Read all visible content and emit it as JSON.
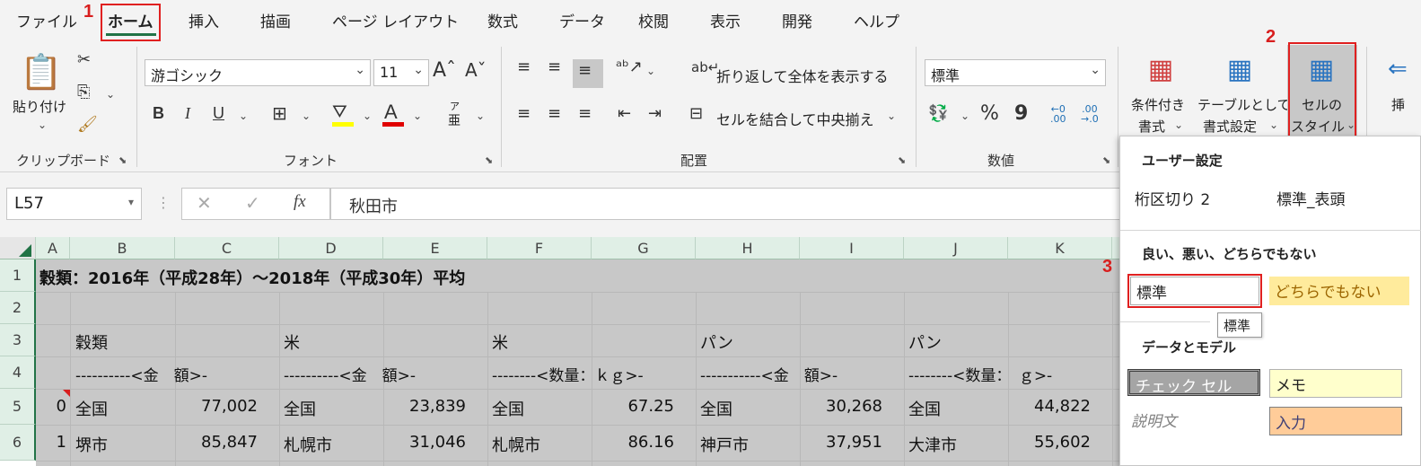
{
  "tabs": [
    "ファイル",
    "ホーム",
    "挿入",
    "描画",
    "ページ レイアウト",
    "数式",
    "データ",
    "校閲",
    "表示",
    "開発",
    "ヘルプ"
  ],
  "steps": [
    "1",
    "2",
    "3"
  ],
  "clipboard": {
    "paste": "貼り付け",
    "group": "クリップボード"
  },
  "font": {
    "name": "游ゴシック",
    "size": "11",
    "group": "フォント",
    "bold": "B",
    "italic": "I",
    "underline": "U",
    "phonetic_top": "ア",
    "phonetic_bottom": "亜"
  },
  "alignment": {
    "wrap": "折り返して全体を表示する",
    "merge": "セルを結合して中央揃え",
    "group": "配置"
  },
  "number": {
    "format": "標準",
    "group": "数値",
    "percent": "%",
    "comma": "9"
  },
  "styles": {
    "conditional_line1": "条件付き",
    "conditional_line2": "書式",
    "table_line1": "テーブルとして",
    "table_line2": "書式設定",
    "cell_line1": "セルの",
    "cell_line2": "スタイル",
    "insert": "挿"
  },
  "formula_bar": {
    "name_box": "L57",
    "fx": "fx",
    "content": "秋田市"
  },
  "columns": [
    "A",
    "B",
    "C",
    "D",
    "E",
    "F",
    "G",
    "H",
    "I",
    "J",
    "K"
  ],
  "rows": [
    "1",
    "2",
    "3",
    "4",
    "5",
    "6"
  ],
  "cells": {
    "title": "穀類：2016年（平成28年）～2018年（平成30年）平均",
    "r3": [
      "穀類",
      "米",
      "米",
      "パン",
      "パン"
    ],
    "r4": [
      "----------<金　額>-",
      "----------<金　額>-",
      "--------<数量：ｋｇ>-",
      "-----------<金　額>-",
      "--------<数量：　ｇ>-"
    ],
    "r5": {
      "a": "0",
      "b": "全国",
      "c": "77,002",
      "d": "全国",
      "e": "23,839",
      "f": "全国",
      "g": "67.25",
      "h": "全国",
      "i": "30,268",
      "j": "全国",
      "k": "44,822"
    },
    "r6": {
      "a": "1",
      "b": "堺市",
      "c": "85,847",
      "d": "札幌市",
      "e": "31,046",
      "f": "札幌市",
      "g": "86.16",
      "h": "神戸市",
      "i": "37,951",
      "j": "大津市",
      "k": "55,602"
    }
  },
  "panel": {
    "user_title": "ユーザー設定",
    "user_items": [
      "桁区切り 2",
      "標準_表頭"
    ],
    "good_title": "良い、悪い、どちらでもない",
    "normal": "標準",
    "neutral": "どちらでもない",
    "tooltip": "標準",
    "data_title": "データとモデル",
    "check_cell": "チェック セル",
    "memo": "メモ",
    "explanatory": "説明文",
    "input": "入力"
  },
  "colors": {
    "accent": "#217346",
    "red": "#e02020",
    "neutral_bg": "#ffeb9c",
    "neutral_fg": "#9c6500",
    "memo_bg": "#ffffcc",
    "input_bg": "#ffcc99",
    "check_bg": "#a5a5a5"
  }
}
